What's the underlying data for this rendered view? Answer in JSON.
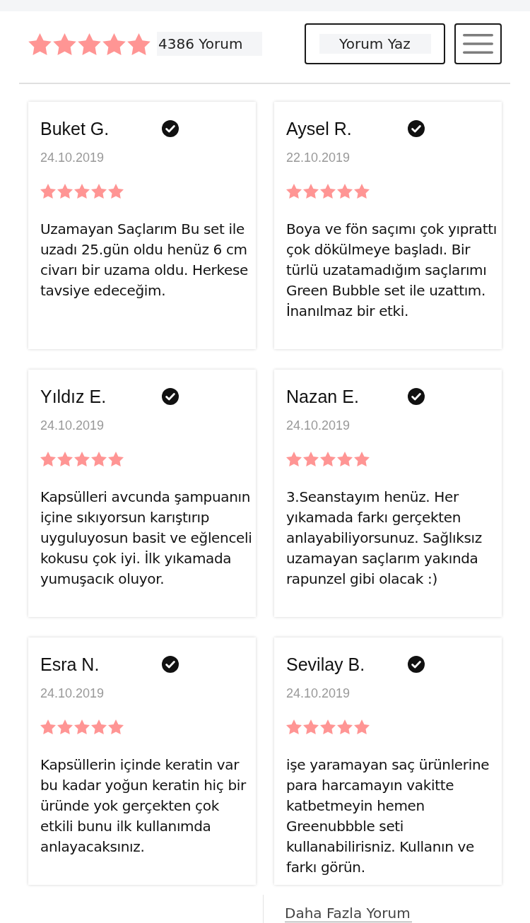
{
  "summary": {
    "stars": 5,
    "count": "4386 Yorum"
  },
  "write_button": {
    "label": "Yorum Yaz"
  },
  "reviews": [
    {
      "name": "Buket G.",
      "verified": true,
      "date": "24.10.2019",
      "stars": 5,
      "text": "Uzamayan Saçlarım Bu set ile uzadı 25.gün oldu henüz 6 cm civarı bir uzama oldu. Herkese tavsiye edeceğim."
    },
    {
      "name": "Aysel R.",
      "verified": true,
      "date": "22.10.2019",
      "stars": 5,
      "text": "Boya ve fön saçımı çok yıprattı çok dökülmeye başladı. Bir türlü uzatamadığım saçlarımı Green Bubble set ile uzattım. İnanılmaz bir etki."
    },
    {
      "name": "Yıldız E.",
      "verified": true,
      "date": "24.10.2019",
      "stars": 5,
      "text": "Kapsülleri avcunda şampuanın içine sıkıyorsun karıştırıp uyguluyosun basit ve eğlenceli kokusu çok iyi. İlk yıkamada yumuşacık oluyor."
    },
    {
      "name": "Nazan E.",
      "verified": true,
      "date": "24.10.2019",
      "stars": 5,
      "text": "3.Seanstayım henüz. Her yıkamada farkı gerçekten anlayabiliyorsunuz. Sağlıksız uzamayan saçlarım yakında rapunzel gibi olacak :)"
    },
    {
      "name": "Esra N.",
      "verified": true,
      "date": "24.10.2019",
      "stars": 5,
      "text": "Kapsüllerin içinde keratin var bu kadar yoğun keratin hiç bir üründe yok gerçekten çok etkili bunu ilk kullanımda anlayacaksınız."
    },
    {
      "name": "Sevilay B.",
      "verified": true,
      "date": "24.10.2019",
      "stars": 5,
      "text": "işe yaramayan saç ürünlerine para harcamayın vakitte katbetmeyin hemen Greenubbble seti kullanabilirisniz. Kullanın ve farkı görün."
    }
  ],
  "more_link": {
    "label": "Daha Fazla Yorum"
  }
}
